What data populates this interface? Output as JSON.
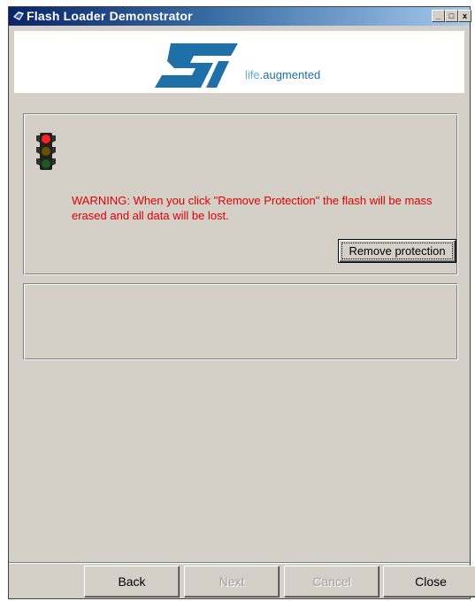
{
  "window": {
    "title": "Flash Loader Demonstrator",
    "controls": {
      "minimize": "_",
      "maximize": "□",
      "close": "x"
    }
  },
  "banner": {
    "tagline_prefix": "life",
    "tagline_suffix": ".augmented",
    "logo_text": "ST"
  },
  "protection": {
    "icon": "traffic-light-icon",
    "warning": "WARNING: When you click \"Remove Protection\" the flash will be mass erased and all data will be lost.",
    "remove_button": "Remove protection"
  },
  "nav": {
    "back": "Back",
    "next": "Next",
    "cancel": "Cancel",
    "close": "Close",
    "next_enabled": false,
    "cancel_enabled": false
  },
  "colors": {
    "warning_text": "#e00000",
    "title_gradient_start": "#0a246a",
    "title_gradient_end": "#a6caf0",
    "logo_blue": "#1f6fa8"
  }
}
